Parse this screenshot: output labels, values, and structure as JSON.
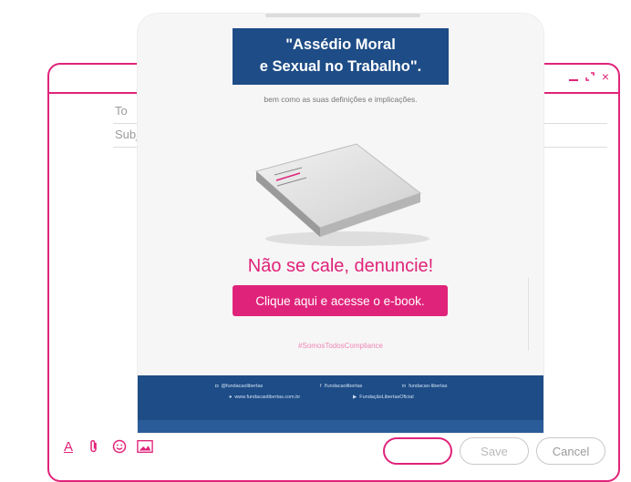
{
  "compose": {
    "to_label": "To",
    "subject_label": "Subject",
    "window_controls": {
      "minimize": "minimize-icon",
      "expand": "expand-icon",
      "close": "close-icon",
      "close_glyph": "×"
    },
    "toolbar": {
      "format_icon": "text-format-icon",
      "attach_icon": "paperclip-icon",
      "emoji_icon": "emoji-icon",
      "image_icon": "image-icon",
      "format_glyph": "A"
    },
    "buttons": {
      "send_label": "",
      "save_label": "Save",
      "cancel_label": "Cancel"
    }
  },
  "preview": {
    "title_line1": "\"Assédio Moral",
    "title_line2": "e Sexual no Trabalho\".",
    "subtitle": "bem como as suas definições e implicações.",
    "headline": "Não se cale, denuncie!",
    "cta_label": "Clique aqui e acesse o e-book.",
    "hashtag": "#SomosTodosCompliance",
    "footer": {
      "social_1": "@fundacaolibertas",
      "social_2": "/fundacaolibertas",
      "social_3": "fundacao-libertas",
      "website": "www.fundacaolibertas.com.br",
      "channel": "FundaçãoLibertasOficial"
    },
    "colors": {
      "brand_pink": "#e0237a",
      "brand_blue": "#1d4c86"
    }
  }
}
